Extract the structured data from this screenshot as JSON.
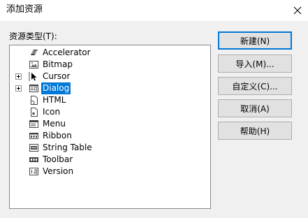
{
  "window": {
    "title": "添加资源",
    "close_icon": "close-icon"
  },
  "list_label": "资源类型(T):",
  "tree": {
    "items": [
      {
        "label": "Accelerator",
        "icon": "accelerator-icon",
        "expandable": false,
        "selected": false
      },
      {
        "label": "Bitmap",
        "icon": "bitmap-icon",
        "expandable": false,
        "selected": false
      },
      {
        "label": "Cursor",
        "icon": "cursor-icon",
        "expandable": true,
        "selected": false
      },
      {
        "label": "Dialog",
        "icon": "dialog-icon",
        "expandable": true,
        "selected": true
      },
      {
        "label": "HTML",
        "icon": "html-icon",
        "expandable": false,
        "selected": false
      },
      {
        "label": "Icon",
        "icon": "icon-resource-icon",
        "expandable": false,
        "selected": false
      },
      {
        "label": "Menu",
        "icon": "menu-icon",
        "expandable": false,
        "selected": false
      },
      {
        "label": "Ribbon",
        "icon": "ribbon-icon",
        "expandable": false,
        "selected": false
      },
      {
        "label": "String Table",
        "icon": "string-table-icon",
        "expandable": false,
        "selected": false
      },
      {
        "label": "Toolbar",
        "icon": "toolbar-icon",
        "expandable": false,
        "selected": false
      },
      {
        "label": "Version",
        "icon": "version-icon",
        "expandable": false,
        "selected": false
      }
    ]
  },
  "buttons": {
    "new": "新建(N)",
    "import": "导入(M)...",
    "custom": "自定义(C)...",
    "cancel": "取消(A)",
    "help": "帮助(H)"
  },
  "colors": {
    "selection": "#0078d7",
    "default_button_border": "#0078d7",
    "dialog_background": "#f0f0f0"
  }
}
